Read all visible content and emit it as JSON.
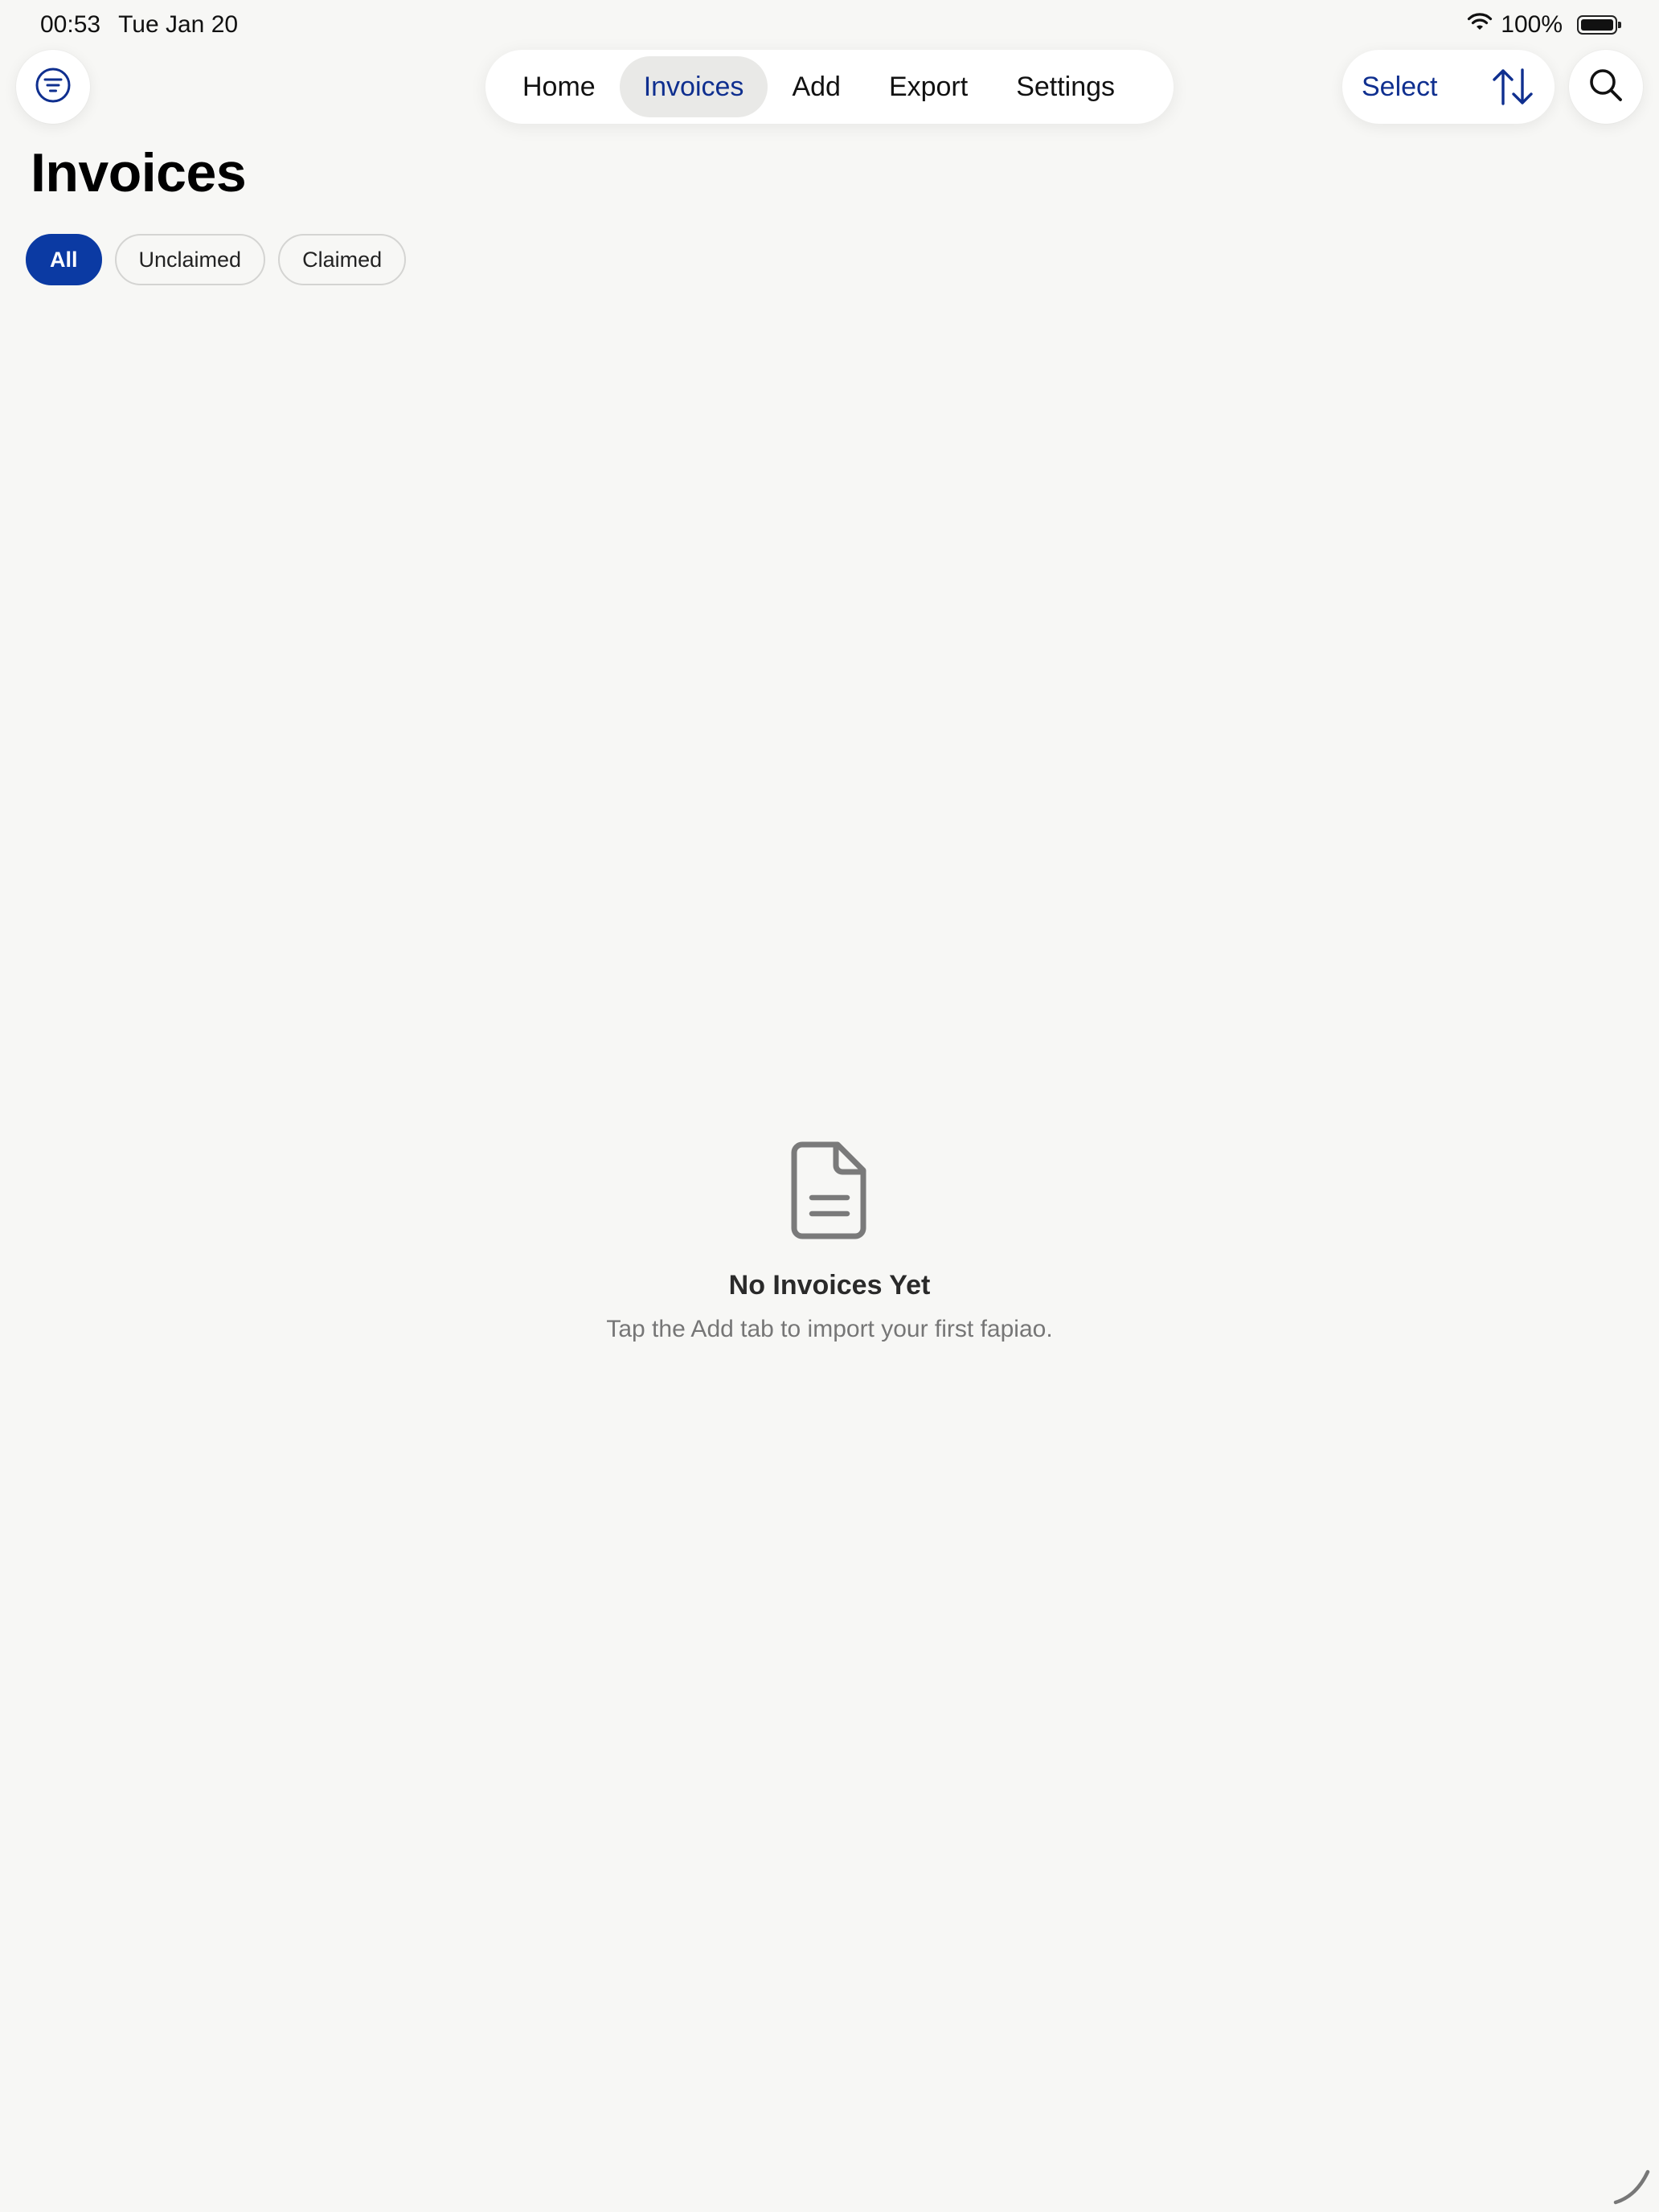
{
  "status_bar": {
    "time": "00:53",
    "date": "Tue Jan 20",
    "battery": "100%",
    "wifi_icon": "wifi-icon",
    "battery_icon": "battery-icon"
  },
  "toolbar": {
    "filter_icon": "filter-circle-icon",
    "tabs": [
      {
        "label": "Home",
        "active": false
      },
      {
        "label": "Invoices",
        "active": true
      },
      {
        "label": "Add",
        "active": false
      },
      {
        "label": "Export",
        "active": false
      },
      {
        "label": "Settings",
        "active": false
      }
    ],
    "select_label": "Select",
    "sort_icon": "sort-arrows-icon",
    "search_icon": "search-icon"
  },
  "page": {
    "title": "Invoices"
  },
  "segments": [
    {
      "label": "All",
      "active": true
    },
    {
      "label": "Unclaimed",
      "active": false
    },
    {
      "label": "Claimed",
      "active": false
    }
  ],
  "empty_state": {
    "icon": "document-icon",
    "title": "No Invoices Yet",
    "subtitle": "Tap the Add tab to import your first fapiao."
  },
  "colors": {
    "accent": "#0b3aa3",
    "accent_text": "#0f2f8f",
    "background": "#f7f7f5"
  }
}
